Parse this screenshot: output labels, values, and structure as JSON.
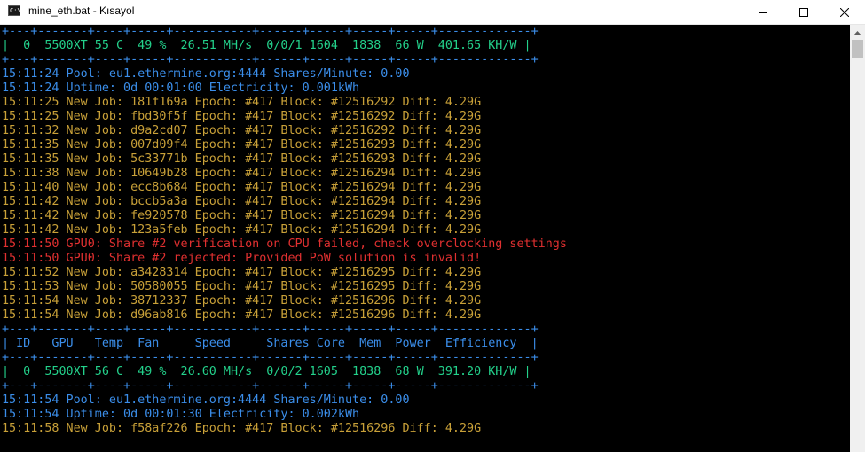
{
  "window": {
    "title": "mine_eth.bat - Kısayol",
    "icon": "console-icon"
  },
  "colors": {
    "border": "#3b8eea",
    "gpu_row": "#23d18b",
    "log_info": "#3b8eea",
    "job": "#c8a038",
    "error": "#e03030",
    "background": "#000000"
  },
  "console": {
    "lines": [
      {
        "kind": "border",
        "text": "+---+-------+----+-----+-----------+------+-----+-----+-----+-------------+"
      },
      {
        "kind": "gpu",
        "text": "|  0  5500XT 55 C  49 %  26.51 MH/s  0/0/1 1604  1838  66 W  401.65 KH/W |"
      },
      {
        "kind": "border",
        "text": "+---+-------+----+-----+-----------+------+-----+-----+-----+-------------+"
      },
      {
        "kind": "info",
        "text": "15:11:24 Pool: eu1.ethermine.org:4444 Shares/Minute: 0.00"
      },
      {
        "kind": "info",
        "text": "15:11:24 Uptime: 0d 00:01:00 Electricity: 0.001kWh"
      },
      {
        "kind": "job",
        "text": "15:11:25 New Job: 181f169a Epoch: #417 Block: #12516292 Diff: 4.29G"
      },
      {
        "kind": "job",
        "text": "15:11:25 New Job: fbd30f5f Epoch: #417 Block: #12516292 Diff: 4.29G"
      },
      {
        "kind": "job",
        "text": "15:11:32 New Job: d9a2cd07 Epoch: #417 Block: #12516292 Diff: 4.29G"
      },
      {
        "kind": "job",
        "text": "15:11:35 New Job: 007d09f4 Epoch: #417 Block: #12516293 Diff: 4.29G"
      },
      {
        "kind": "job",
        "text": "15:11:35 New Job: 5c33771b Epoch: #417 Block: #12516293 Diff: 4.29G"
      },
      {
        "kind": "job",
        "text": "15:11:38 New Job: 10649b28 Epoch: #417 Block: #12516294 Diff: 4.29G"
      },
      {
        "kind": "job",
        "text": "15:11:40 New Job: ecc8b684 Epoch: #417 Block: #12516294 Diff: 4.29G"
      },
      {
        "kind": "job",
        "text": "15:11:42 New Job: bccb5a3a Epoch: #417 Block: #12516294 Diff: 4.29G"
      },
      {
        "kind": "job",
        "text": "15:11:42 New Job: fe920578 Epoch: #417 Block: #12516294 Diff: 4.29G"
      },
      {
        "kind": "job",
        "text": "15:11:42 New Job: 123a5feb Epoch: #417 Block: #12516294 Diff: 4.29G"
      },
      {
        "kind": "error",
        "text": "15:11:50 GPU0: Share #2 verification on CPU failed, check overclocking settings"
      },
      {
        "kind": "error",
        "text": "15:11:50 GPU0: Share #2 rejected: Provided PoW solution is invalid!"
      },
      {
        "kind": "job",
        "text": "15:11:52 New Job: a3428314 Epoch: #417 Block: #12516295 Diff: 4.29G"
      },
      {
        "kind": "job",
        "text": "15:11:53 New Job: 50580055 Epoch: #417 Block: #12516295 Diff: 4.29G"
      },
      {
        "kind": "job",
        "text": "15:11:54 New Job: 38712337 Epoch: #417 Block: #12516296 Diff: 4.29G"
      },
      {
        "kind": "job",
        "text": "15:11:54 New Job: d96ab816 Epoch: #417 Block: #12516296 Diff: 4.29G"
      },
      {
        "kind": "border",
        "text": "+---+-------+----+-----+-----------+------+-----+-----+-----+-------------+"
      },
      {
        "kind": "header",
        "text": "| ID   GPU   Temp  Fan     Speed     Shares Core  Mem  Power  Efficiency  |"
      },
      {
        "kind": "border",
        "text": "+---+-------+----+-----+-----------+------+-----+-----+-----+-------------+"
      },
      {
        "kind": "gpu",
        "text": "|  0  5500XT 56 C  49 %  26.60 MH/s  0/0/2 1605  1838  68 W  391.20 KH/W |"
      },
      {
        "kind": "border",
        "text": "+---+-------+----+-----+-----------+------+-----+-----+-----+-------------+"
      },
      {
        "kind": "info",
        "text": "15:11:54 Pool: eu1.ethermine.org:4444 Shares/Minute: 0.00"
      },
      {
        "kind": "info",
        "text": "15:11:54 Uptime: 0d 00:01:30 Electricity: 0.002kWh"
      },
      {
        "kind": "job",
        "text": "15:11:58 New Job: f58af226 Epoch: #417 Block: #12516296 Diff: 4.29G"
      }
    ]
  }
}
